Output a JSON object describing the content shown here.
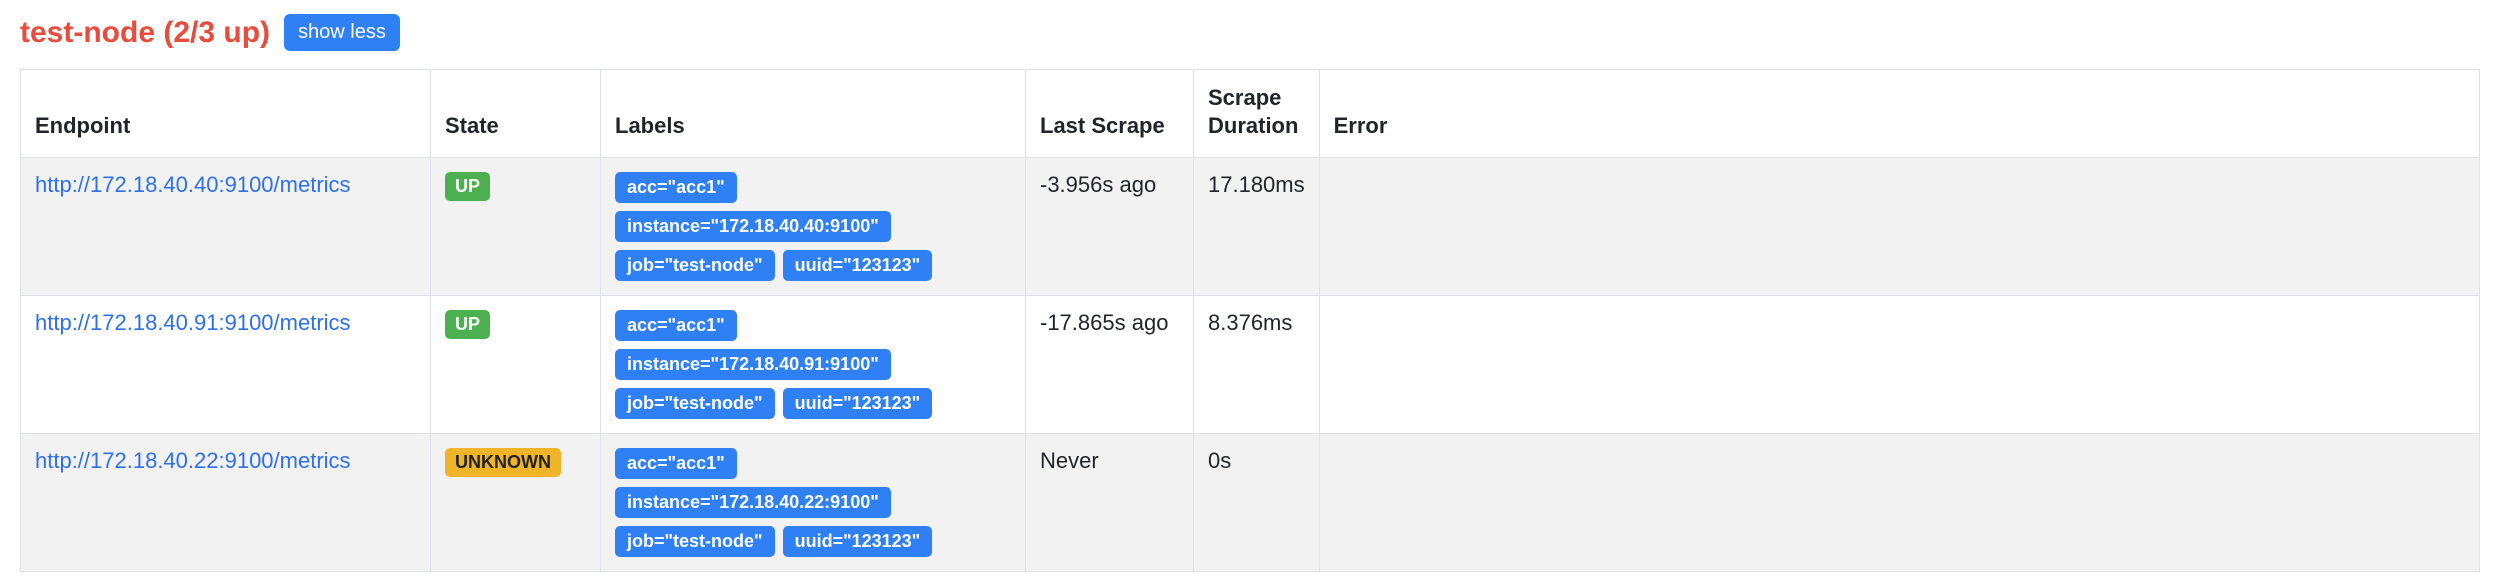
{
  "header": {
    "title": "test-node (2/3 up)",
    "toggle_label": "show less"
  },
  "columns": {
    "endpoint": "Endpoint",
    "state": "State",
    "labels": "Labels",
    "last_scrape": "Last Scrape",
    "scrape_duration": "Scrape Duration",
    "error": "Error"
  },
  "targets": [
    {
      "endpoint": "http://172.18.40.40:9100/metrics",
      "state": "UP",
      "state_kind": "up",
      "labels": [
        "acc=\"acc1\"",
        "instance=\"172.18.40.40:9100\"",
        "job=\"test-node\"",
        "uuid=\"123123\""
      ],
      "last_scrape": "-3.956s ago",
      "scrape_duration": "17.180ms",
      "error": ""
    },
    {
      "endpoint": "http://172.18.40.91:9100/metrics",
      "state": "UP",
      "state_kind": "up",
      "labels": [
        "acc=\"acc1\"",
        "instance=\"172.18.40.91:9100\"",
        "job=\"test-node\"",
        "uuid=\"123123\""
      ],
      "last_scrape": "-17.865s ago",
      "scrape_duration": "8.376ms",
      "error": ""
    },
    {
      "endpoint": "http://172.18.40.22:9100/metrics",
      "state": "UNKNOWN",
      "state_kind": "unknown",
      "labels": [
        "acc=\"acc1\"",
        "instance=\"172.18.40.22:9100\"",
        "job=\"test-node\"",
        "uuid=\"123123\""
      ],
      "last_scrape": "Never",
      "scrape_duration": "0s",
      "error": ""
    }
  ]
}
